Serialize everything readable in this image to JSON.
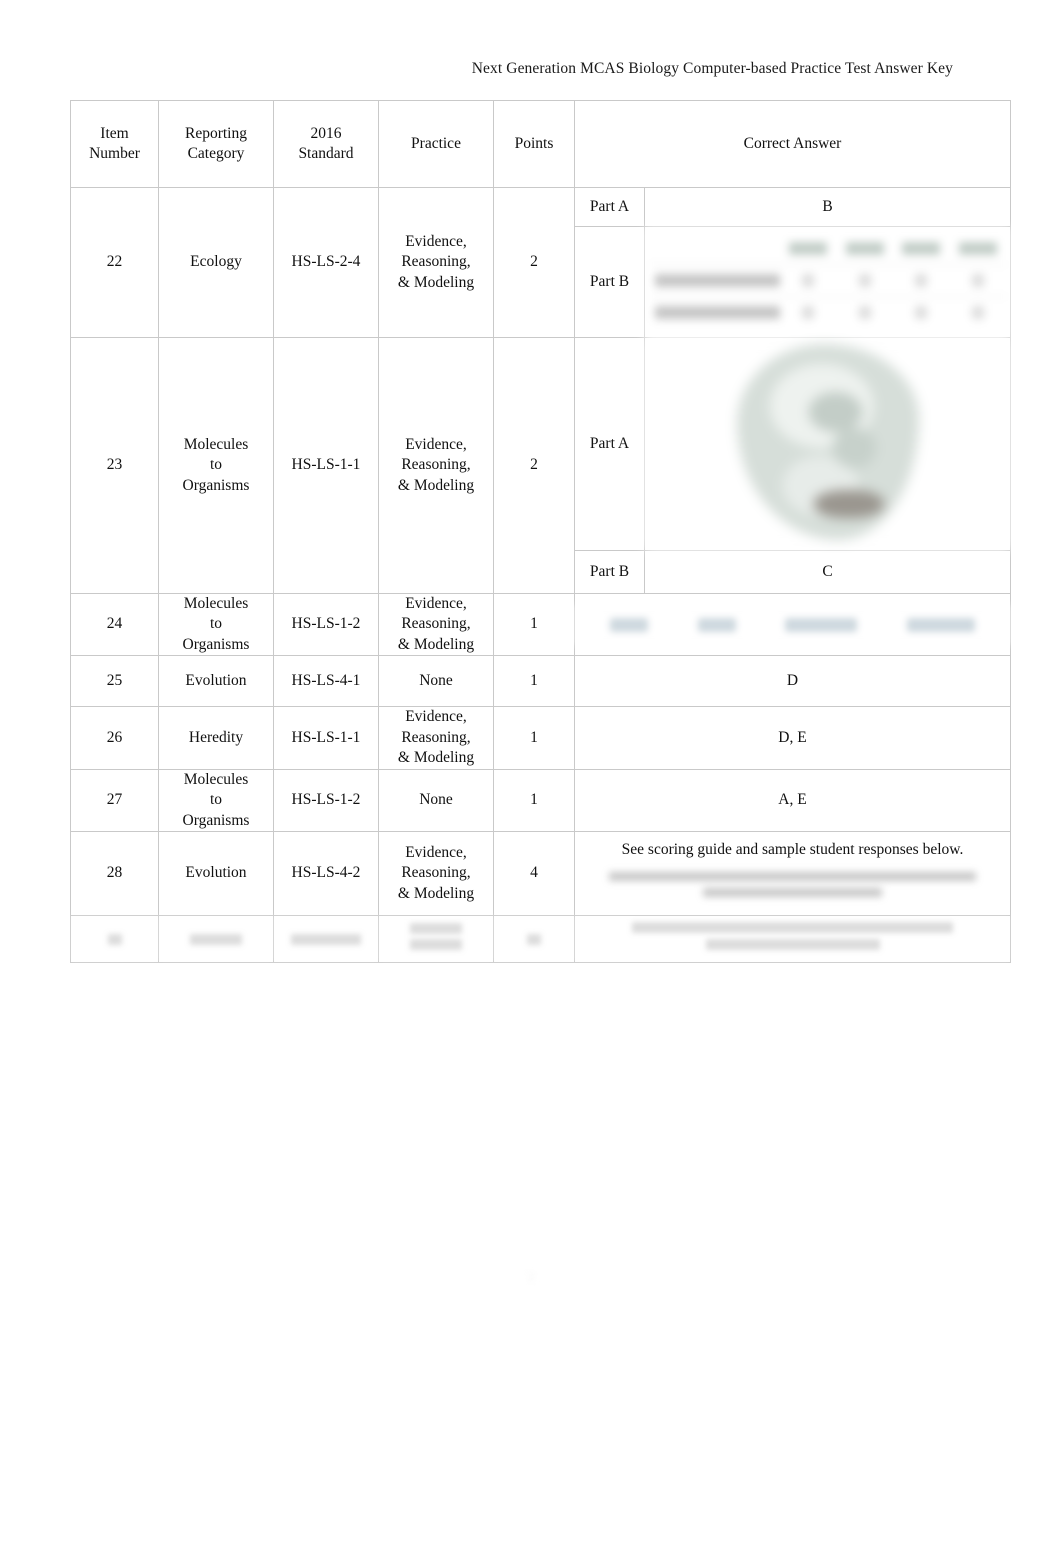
{
  "document": {
    "running_header": "Next Generation MCAS Biology Computer-based Practice Test Answer Key",
    "page_number": "2"
  },
  "table": {
    "headers": {
      "item_number_line1": "Item",
      "item_number_line2": "Number",
      "reporting_category_line1": "Reporting",
      "reporting_category_line2": "Category",
      "standard_line1": "2016",
      "standard_line2": "Standard",
      "practice": "Practice",
      "points": "Points",
      "correct_answer": "Correct Answer"
    },
    "rows": [
      {
        "item_number": "22",
        "reporting_category": "Ecology",
        "standard": "HS-LS-2-4",
        "practice_line1": "Evidence,",
        "practice_line2": "Reasoning,",
        "practice_line3": "& Modeling",
        "points": "2",
        "parts": [
          {
            "label": "Part A",
            "answer": "B",
            "answer_type": "text"
          },
          {
            "label": "Part B",
            "answer": "",
            "answer_type": "blurred-mini-table"
          }
        ]
      },
      {
        "item_number": "23",
        "reporting_category_line1": "Molecules",
        "reporting_category_line2": "to",
        "reporting_category_line3": "Organisms",
        "standard": "HS-LS-1-1",
        "practice_line1": "Evidence,",
        "practice_line2": "Reasoning,",
        "practice_line3": "& Modeling",
        "points": "2",
        "parts": [
          {
            "label": "Part A",
            "answer": "",
            "answer_type": "blurred-cell-diagram"
          },
          {
            "label": "Part B",
            "answer": "C",
            "answer_type": "text"
          }
        ]
      },
      {
        "item_number": "24",
        "reporting_category_line1": "Molecules",
        "reporting_category_line2": "to",
        "reporting_category_line3": "Organisms",
        "standard": "HS-LS-1-2",
        "practice_line1": "Evidence,",
        "practice_line2": "Reasoning,",
        "practice_line3": "& Modeling",
        "points": "1",
        "answer": "",
        "answer_type": "blurred-chip-row"
      },
      {
        "item_number": "25",
        "reporting_category": "Evolution",
        "standard": "HS-LS-4-1",
        "practice": "None",
        "points": "1",
        "answer": "D",
        "answer_type": "text"
      },
      {
        "item_number": "26",
        "reporting_category": "Heredity",
        "standard": "HS-LS-1-1",
        "practice_line1": "Evidence,",
        "practice_line2": "Reasoning,",
        "practice_line3": "& Modeling",
        "points": "1",
        "answer": "D, E",
        "answer_type": "text"
      },
      {
        "item_number": "27",
        "reporting_category_line1": "Molecules",
        "reporting_category_line2": "to",
        "reporting_category_line3": "Organisms",
        "standard": "HS-LS-1-2",
        "practice": "None",
        "points": "1",
        "answer": "A, E",
        "answer_type": "text"
      },
      {
        "item_number": "28",
        "reporting_category": "Evolution",
        "standard": "HS-LS-4-2",
        "practice_line1": "Evidence,",
        "practice_line2": "Reasoning,",
        "practice_line3": "& Modeling",
        "points": "4",
        "answer": "See scoring guide and sample student responses below.",
        "answer_type": "text-with-blurred-block"
      },
      {
        "item_number": "",
        "reporting_category": "",
        "standard": "",
        "practice": "",
        "points": "",
        "answer": "",
        "answer_type": "faded-illegible"
      }
    ]
  }
}
